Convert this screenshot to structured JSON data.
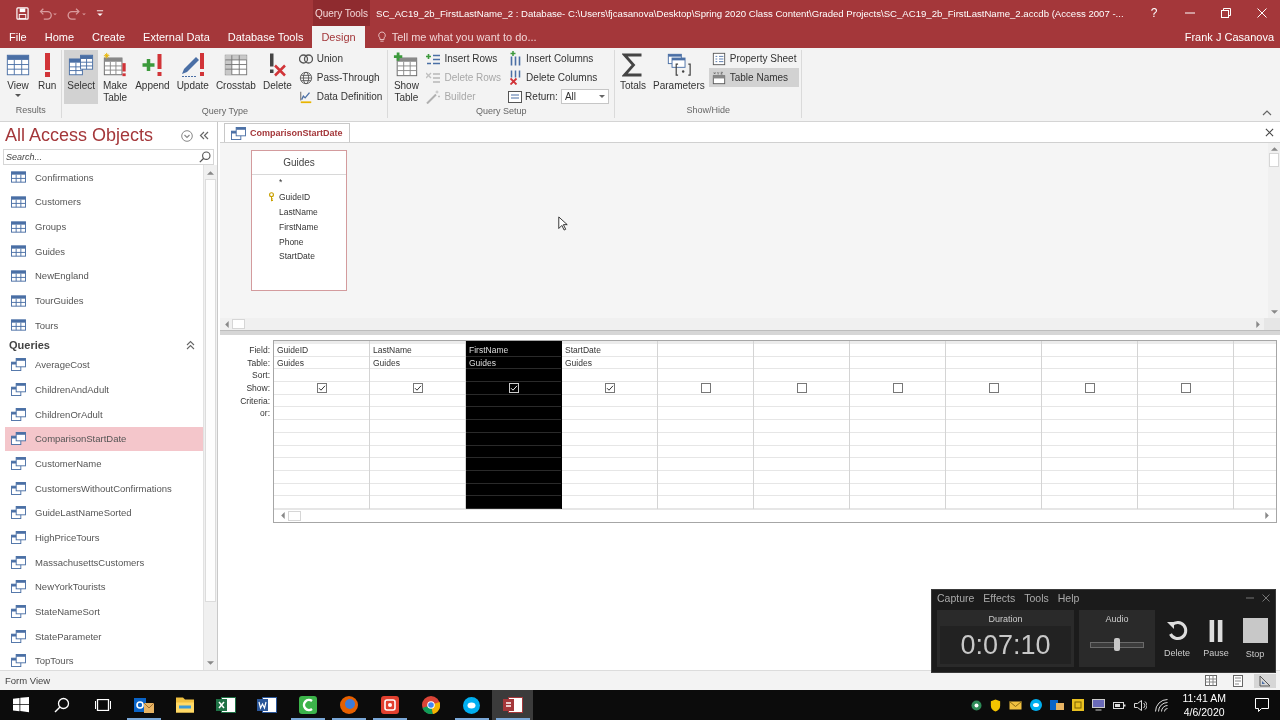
{
  "title_bar": {
    "context_label": "Query Tools",
    "title": "SC_AC19_2b_FirstLastName_2 : Database- C:\\Users\\fjcasanova\\Desktop\\Spring 2020 Class Content\\Graded Projects\\SC_AC19_2b_FirstLastName_2.accdb (Access 2007 -...",
    "help": "?"
  },
  "ribbon_tabs": [
    {
      "label": "File",
      "selected": false
    },
    {
      "label": "Home",
      "selected": false
    },
    {
      "label": "Create",
      "selected": false
    },
    {
      "label": "External Data",
      "selected": false
    },
    {
      "label": "Database Tools",
      "selected": false
    },
    {
      "label": "Design",
      "selected": true
    }
  ],
  "tell_me": {
    "placeholder": "Tell me what you want to do..."
  },
  "user": "Frank J Casanova",
  "ribbon": {
    "results": {
      "label": "Results",
      "items": [
        {
          "label": "View",
          "kind": "large_dropdown"
        },
        {
          "label": "Run",
          "kind": "large"
        }
      ]
    },
    "query_type": {
      "label": "Query Type",
      "items": [
        {
          "label": "Select",
          "kind": "large",
          "selected": true
        },
        {
          "label": "Make Table",
          "kind": "large",
          "selected": false
        },
        {
          "label": "Append",
          "kind": "large",
          "selected": false
        },
        {
          "label": "Update",
          "kind": "large",
          "selected": false
        },
        {
          "label": "Crosstab",
          "kind": "large",
          "selected": false
        },
        {
          "label": "Delete",
          "kind": "large",
          "selected": false
        },
        {
          "label": "Union",
          "kind": "small",
          "selected": false
        },
        {
          "label": "Pass-Through",
          "kind": "small",
          "selected": false
        },
        {
          "label": "Data Definition",
          "kind": "small",
          "selected": false
        }
      ]
    },
    "query_setup": {
      "label": "Query Setup",
      "items": [
        {
          "label": "Show Table",
          "kind": "large",
          "disabled": false
        },
        {
          "label": "Insert Rows",
          "kind": "small",
          "disabled": false
        },
        {
          "label": "Delete Rows",
          "kind": "small",
          "disabled": true
        },
        {
          "label": "Builder",
          "kind": "small",
          "disabled": true
        },
        {
          "label": "Insert Columns",
          "kind": "small",
          "disabled": false
        },
        {
          "label": "Delete Columns",
          "kind": "small",
          "disabled": false
        }
      ],
      "return": {
        "label": "Return:",
        "value": "All"
      }
    },
    "show_hide": {
      "label": "Show/Hide",
      "items": [
        {
          "label": "Totals",
          "kind": "large",
          "selected": false
        },
        {
          "label": "Parameters",
          "kind": "large",
          "selected": false
        },
        {
          "label": "Property Sheet",
          "kind": "small",
          "selected": false
        },
        {
          "label": "Table Names",
          "kind": "small",
          "selected": true
        }
      ]
    }
  },
  "nav_pane": {
    "title": "All Access Objects",
    "search": {
      "placeholder": "Search..."
    },
    "tables": [
      {
        "label": "Confirmations",
        "selected": false
      },
      {
        "label": "Customers",
        "selected": false
      },
      {
        "label": "Groups",
        "selected": false
      },
      {
        "label": "Guides",
        "selected": false
      },
      {
        "label": "NewEngland",
        "selected": false
      },
      {
        "label": "TourGuides",
        "selected": false
      },
      {
        "label": "Tours",
        "selected": false
      }
    ],
    "queries": {
      "label": "Queries",
      "expanded": true,
      "items": [
        {
          "label": "AverageCost",
          "selected": false
        },
        {
          "label": "ChildrenAndAdult",
          "selected": false
        },
        {
          "label": "ChildrenOrAdult",
          "selected": false
        },
        {
          "label": "ComparisonStartDate",
          "selected": true
        },
        {
          "label": "CustomerName",
          "selected": false
        },
        {
          "label": "CustomersWithoutConfirmations",
          "selected": false
        },
        {
          "label": "GuideLastNameSorted",
          "selected": false
        },
        {
          "label": "HighPriceTours",
          "selected": false
        },
        {
          "label": "MassachusettsCustomers",
          "selected": false
        },
        {
          "label": "NewYorkTourists",
          "selected": false
        },
        {
          "label": "StateNameSort",
          "selected": false
        },
        {
          "label": "StateParameter",
          "selected": false
        },
        {
          "label": "TopTours",
          "selected": false
        }
      ]
    }
  },
  "document_tab": {
    "label": "ComparisonStartDate"
  },
  "field_list": {
    "title": "Guides",
    "fields": [
      {
        "name": "*",
        "key": false
      },
      {
        "name": "GuideID",
        "key": true
      },
      {
        "name": "LastName",
        "key": false
      },
      {
        "name": "FirstName",
        "key": false
      },
      {
        "name": "Phone",
        "key": false
      },
      {
        "name": "StartDate",
        "key": false
      }
    ]
  },
  "design_grid": {
    "row_labels": [
      "Field:",
      "Table:",
      "Sort:",
      "Show:",
      "Criteria:",
      "or:"
    ],
    "columns": [
      {
        "field": "GuideID",
        "table": "Guides",
        "show": true,
        "selected": false
      },
      {
        "field": "LastName",
        "table": "Guides",
        "show": true,
        "selected": false
      },
      {
        "field": "FirstName",
        "table": "Guides",
        "show": true,
        "selected": true
      },
      {
        "field": "StartDate",
        "table": "Guides",
        "show": true,
        "selected": false
      },
      {
        "show": false,
        "selected": false
      },
      {
        "show": false,
        "selected": false
      },
      {
        "show": false,
        "selected": false
      },
      {
        "show": false,
        "selected": false
      },
      {
        "show": false,
        "selected": false
      },
      {
        "show": false,
        "selected": false
      }
    ]
  },
  "status_bar": {
    "text": "Form View",
    "views": [
      {
        "selected": false
      },
      {
        "selected": false
      },
      {
        "selected": true
      }
    ]
  },
  "recorder": {
    "menu": [
      "Capture",
      "Effects",
      "Tools",
      "Help"
    ],
    "duration": {
      "label": "Duration",
      "value": "0:07:10"
    },
    "audio": {
      "label": "Audio",
      "level": 0.5
    },
    "buttons": [
      {
        "label": "Delete",
        "kind": "delete"
      },
      {
        "label": "Pause",
        "kind": "pause"
      },
      {
        "label": "Stop",
        "kind": "stop"
      }
    ]
  },
  "taskbar": {
    "apps": [
      {
        "running": true,
        "selected": false
      },
      {
        "running": false,
        "selected": false
      },
      {
        "running": false,
        "selected": false
      },
      {
        "running": false,
        "selected": false
      },
      {
        "running": true,
        "selected": false
      },
      {
        "running": true,
        "selected": false
      },
      {
        "running": true,
        "selected": false
      },
      {
        "running": false,
        "selected": false
      },
      {
        "running": true,
        "selected": false
      },
      {
        "running": true,
        "selected": true
      }
    ],
    "clock": {
      "time": "11:41 AM",
      "date": "4/6/2020"
    }
  }
}
